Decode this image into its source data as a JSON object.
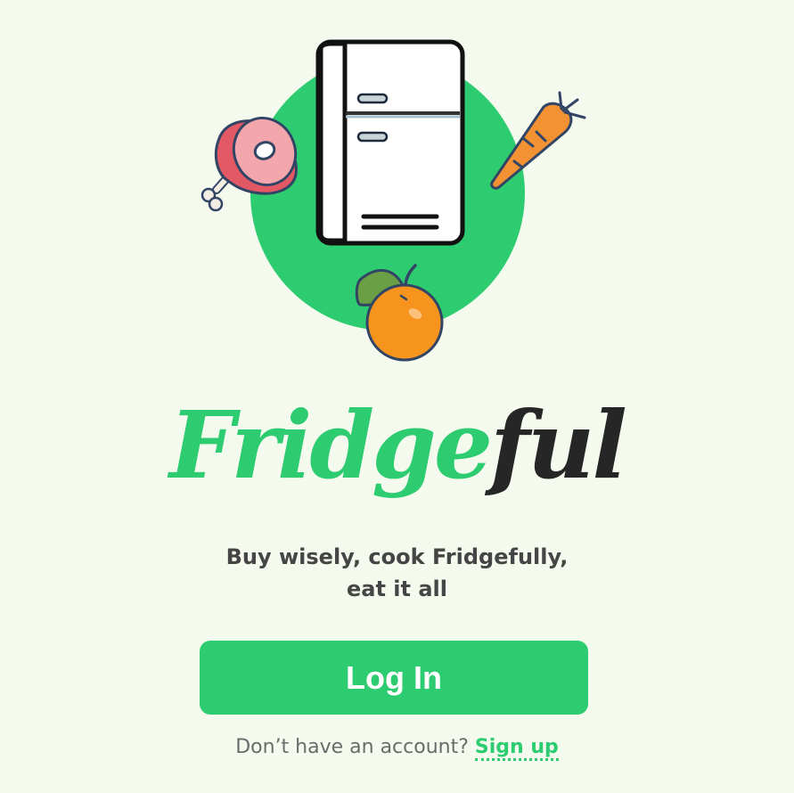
{
  "app": {
    "title_part1": "Fridge",
    "title_part2": "ful"
  },
  "tagline": {
    "line1": "Buy wisely, cook Fridgefully,",
    "line2": "eat it all"
  },
  "actions": {
    "login_label": "Log In",
    "signup_prompt": "Don’t have an account?",
    "signup_label": "Sign up"
  },
  "illustration": {
    "icons": [
      "refrigerator-icon",
      "ham-icon",
      "carrot-icon",
      "orange-icon"
    ],
    "colors": {
      "accent": "#2ecc71",
      "background": "#f5faee",
      "dark_text": "#262626"
    }
  }
}
